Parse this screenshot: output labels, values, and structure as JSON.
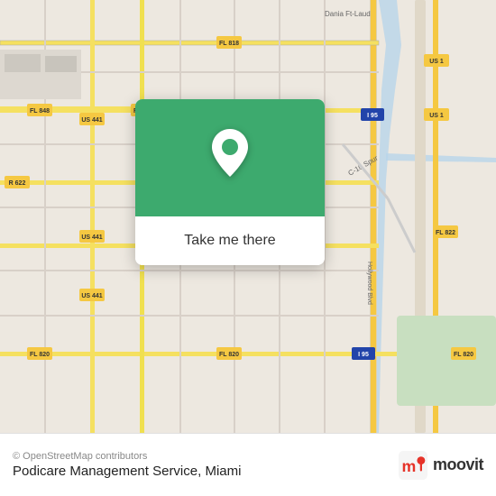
{
  "map": {
    "attribution": "© OpenStreetMap contributors",
    "background_color": "#e8e0d8"
  },
  "card": {
    "button_label": "Take me there",
    "bg_color": "#3daa6e",
    "pin_icon": "📍"
  },
  "bottom_bar": {
    "attribution": "© OpenStreetMap contributors",
    "place_name": "Podicare Management Service, Miami",
    "moovit_label": "moovit"
  },
  "roads": {
    "highway_color": "#f5c842",
    "road_color": "#ffffff",
    "arterial_color": "#fffde0",
    "water_color": "#b0d4f1",
    "park_color": "#c8e6c9",
    "label_color": "#555555"
  }
}
